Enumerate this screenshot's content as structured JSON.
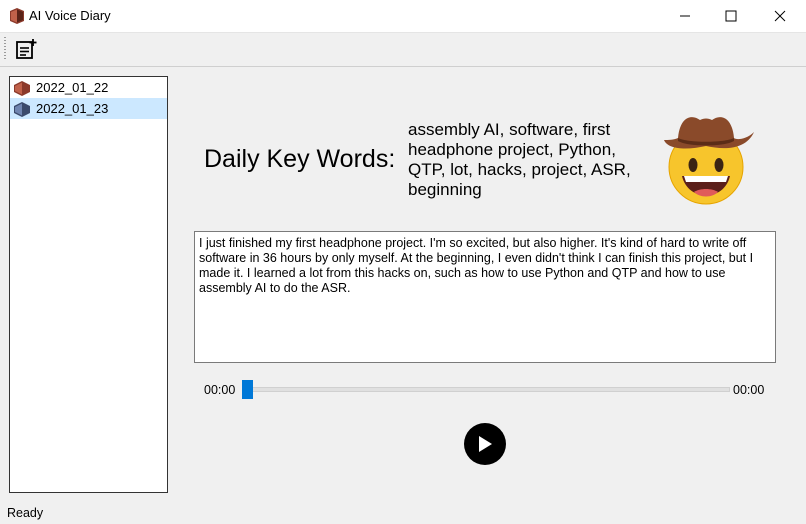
{
  "window": {
    "title": "AI Voice Diary"
  },
  "toolbar": {
    "new_entry_icon": "new-note-icon"
  },
  "entries": [
    {
      "label": "2022_01_22",
      "selected": false
    },
    {
      "label": "2022_01_23",
      "selected": true
    }
  ],
  "keywords": {
    "heading": "Daily Key Words:",
    "text": "assembly AI, software, first headphone project, Python, QTP, lot, hacks, project, ASR, beginning",
    "mood_icon": "cowboy-smiley-emoji"
  },
  "transcript": "I just finished my first headphone project. I'm so excited, but also higher. It's kind of hard to write off software in 36 hours by only myself. At the beginning, I even didn't think I can finish this project, but I made it. I learned a lot from this hacks on, such as how to use Python and QTP and how to use assembly AI to do the ASR.",
  "player": {
    "current_time": "00:00",
    "total_time": "00:00",
    "progress": 0
  },
  "status": "Ready",
  "colors": {
    "selection": "#cce8ff",
    "accent": "#0078d7"
  }
}
